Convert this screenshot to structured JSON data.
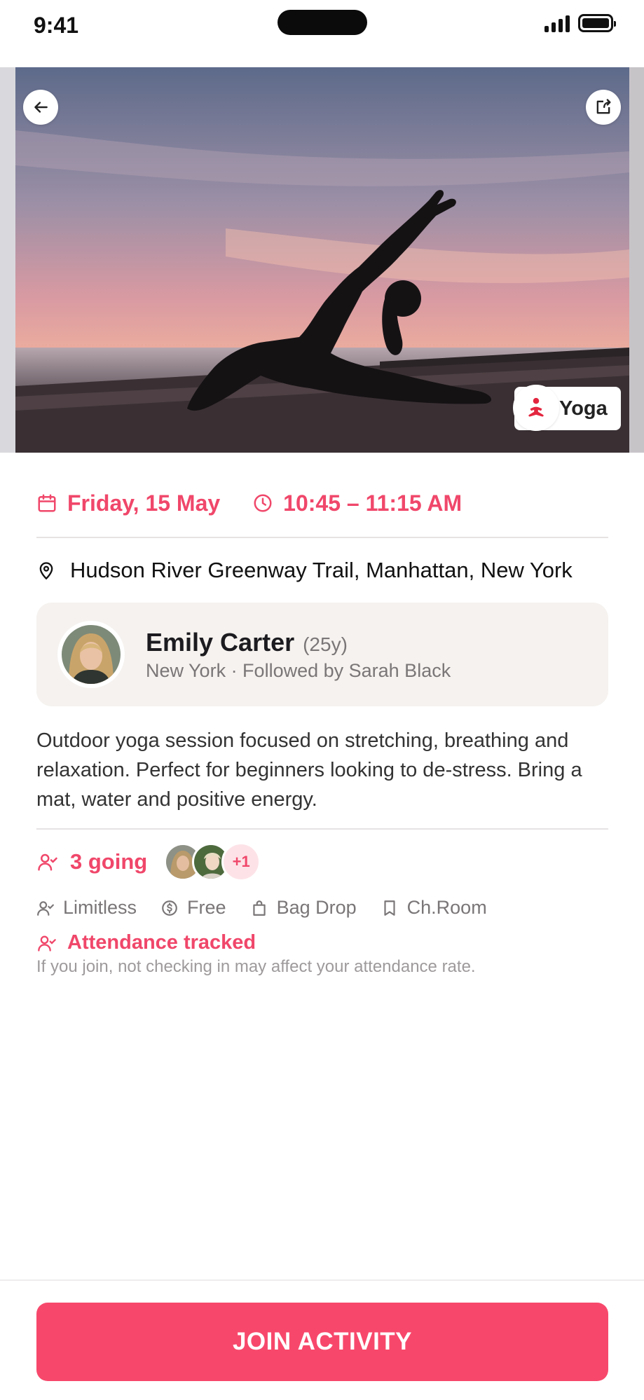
{
  "status_bar": {
    "time": "9:41"
  },
  "hero": {
    "image_subject": "yoga-silhouette-sunset",
    "tag_label": "Yoga",
    "tag_icon": "yoga-pose-icon",
    "back_icon": "arrow-left-icon",
    "share_icon": "share-icon"
  },
  "event": {
    "date": "Friday, 15 May",
    "time": "10:45 – 11:15 AM",
    "location": "Hudson River Greenway Trail, Manhattan, New York",
    "description": "Outdoor yoga session focused on stretching, breathing and relaxation. Perfect for beginners looking to de-stress. Bring a mat, water and positive energy."
  },
  "host": {
    "name": "Emily Carter",
    "age": "(25y)",
    "meta": "New York · Followed by Sarah Black"
  },
  "attendees": {
    "going_label": "3 going",
    "extra": "+1"
  },
  "features": [
    {
      "label": "Limitless",
      "icon": "user-check-icon"
    },
    {
      "label": "Free",
      "icon": "coin-icon"
    },
    {
      "label": "Bag Drop",
      "icon": "bag-icon"
    },
    {
      "label": "Ch.Room",
      "icon": "bookmark-icon"
    }
  ],
  "attendance": {
    "title": "Attendance tracked",
    "note": "If you join, not checking in may affect your attendance rate."
  },
  "cta": {
    "label": "JOIN ACTIVITY"
  },
  "colors": {
    "accent": "#f0476a",
    "button": "#f7486b",
    "card": "#f5f2ef"
  }
}
